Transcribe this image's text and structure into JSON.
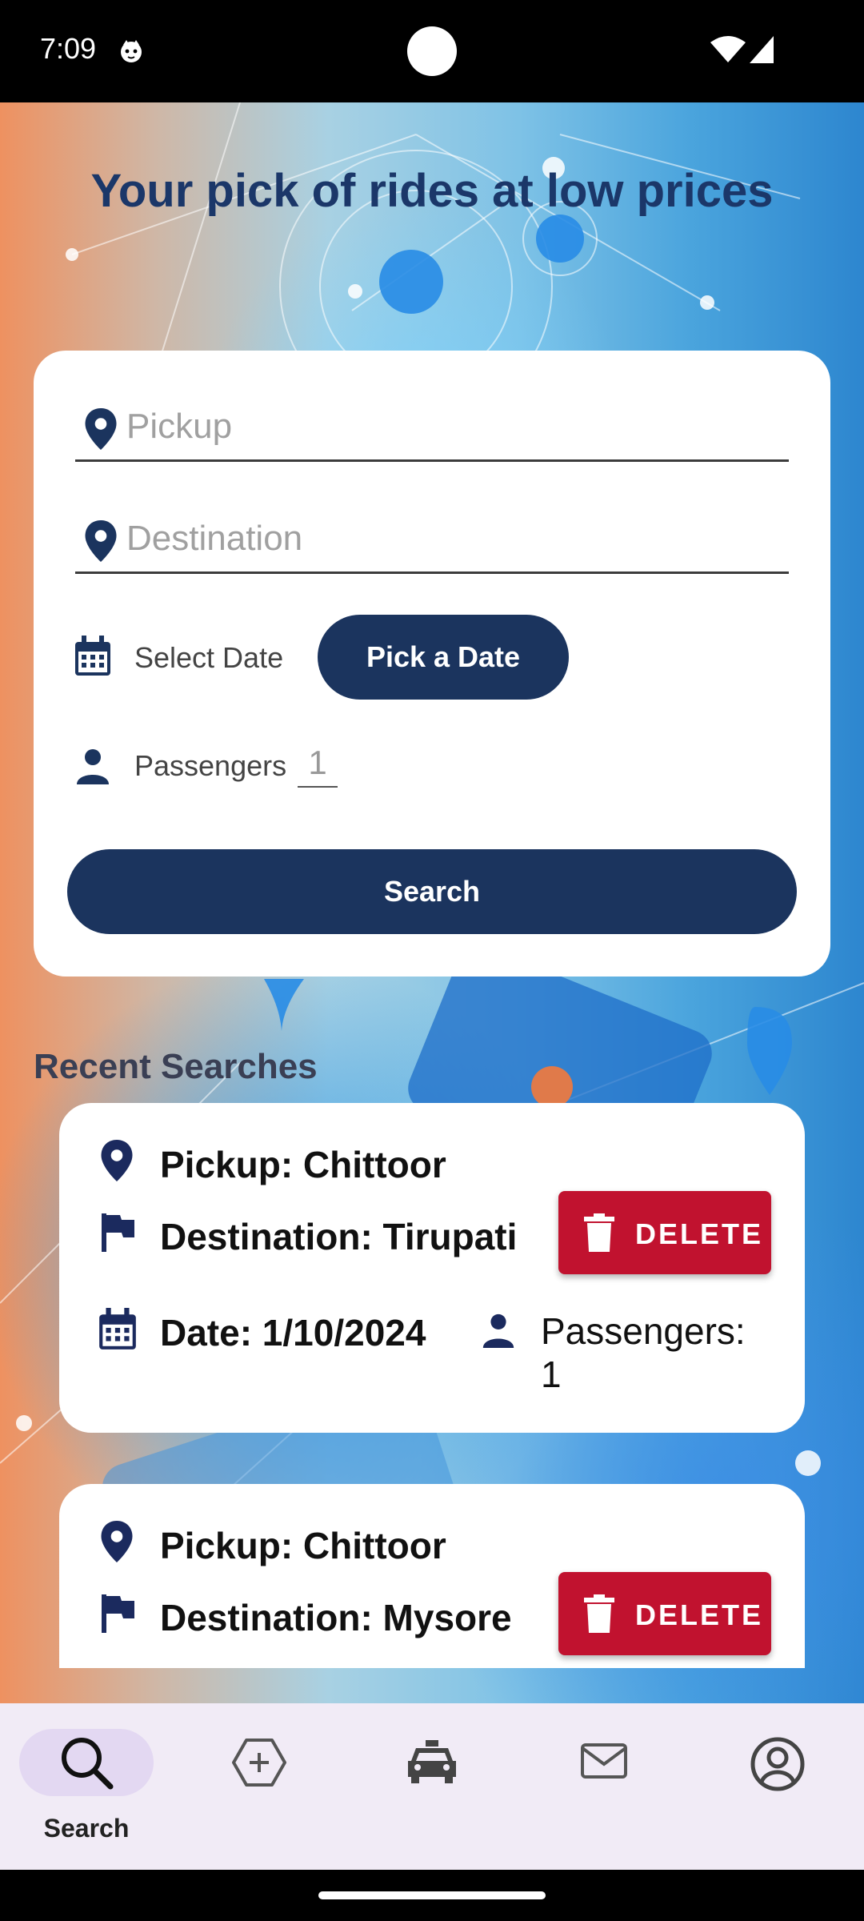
{
  "status_bar": {
    "time": "7:09"
  },
  "headline": "Your pick of rides at low prices",
  "search_form": {
    "pickup_placeholder": "Pickup",
    "destination_placeholder": "Destination",
    "select_date_label": "Select Date",
    "pick_date_button": "Pick a Date",
    "passengers_label": "Passengers",
    "passengers_value": "1",
    "search_button": "Search"
  },
  "recent_searches": {
    "title": "Recent Searches",
    "items": [
      {
        "pickup": "Pickup: Chittoor",
        "destination": "Destination: Tirupati",
        "date": "Date: 1/10/2024",
        "passengers_label": "Passengers:",
        "passengers_value": "1",
        "delete_label": "DELETE"
      },
      {
        "pickup": "Pickup: Chittoor",
        "destination": "Destination: Mysore",
        "delete_label": "DELETE"
      }
    ]
  },
  "bottom_nav": {
    "items": [
      {
        "label": "Search",
        "icon": "search-icon",
        "active": true
      },
      {
        "label": "",
        "icon": "add-ride-icon"
      },
      {
        "label": "",
        "icon": "car-icon"
      },
      {
        "label": "",
        "icon": "mail-icon"
      },
      {
        "label": "",
        "icon": "profile-icon"
      }
    ]
  },
  "colors": {
    "primary": "#1b345e",
    "headline": "#1b3769",
    "delete": "#c1122f",
    "nav_background": "#f1ebf6",
    "nav_active_pill": "#e3d8f2"
  }
}
